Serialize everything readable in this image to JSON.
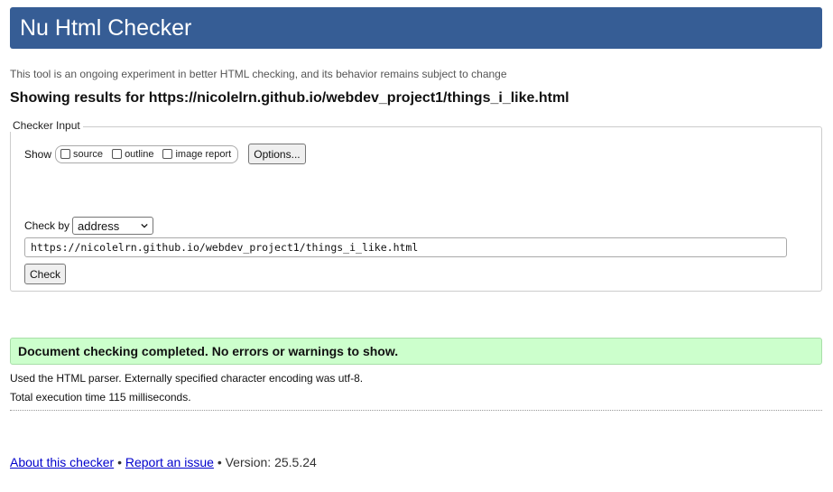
{
  "header": {
    "title": "Nu Html Checker"
  },
  "tagline": "This tool is an ongoing experiment in better HTML checking, and its behavior remains subject to change",
  "results_heading": "Showing results for https://nicolelrn.github.io/webdev_project1/things_i_like.html",
  "checker_input": {
    "legend": "Checker Input",
    "show_label": "Show",
    "show_options": [
      {
        "label": "source",
        "checked": false
      },
      {
        "label": "outline",
        "checked": false
      },
      {
        "label": "image report",
        "checked": false
      }
    ],
    "options_button": "Options...",
    "check_by_label": "Check by",
    "check_by_value": "address",
    "url_value": "https://nicolelrn.github.io/webdev_project1/things_i_like.html",
    "check_button": "Check"
  },
  "result": {
    "success_message": "Document checking completed. No errors or warnings to show.",
    "success_color": "#ccffcc",
    "parser_info": "Used the HTML parser. Externally specified character encoding was utf-8.",
    "execution_time": "Total execution time 115 milliseconds."
  },
  "footer": {
    "about_link": "About this checker",
    "separator": "•",
    "report_link": "Report an issue",
    "version": "• Version: 25.5.24"
  },
  "colors": {
    "header_bg": "#365d95",
    "link": "#0000cc"
  }
}
